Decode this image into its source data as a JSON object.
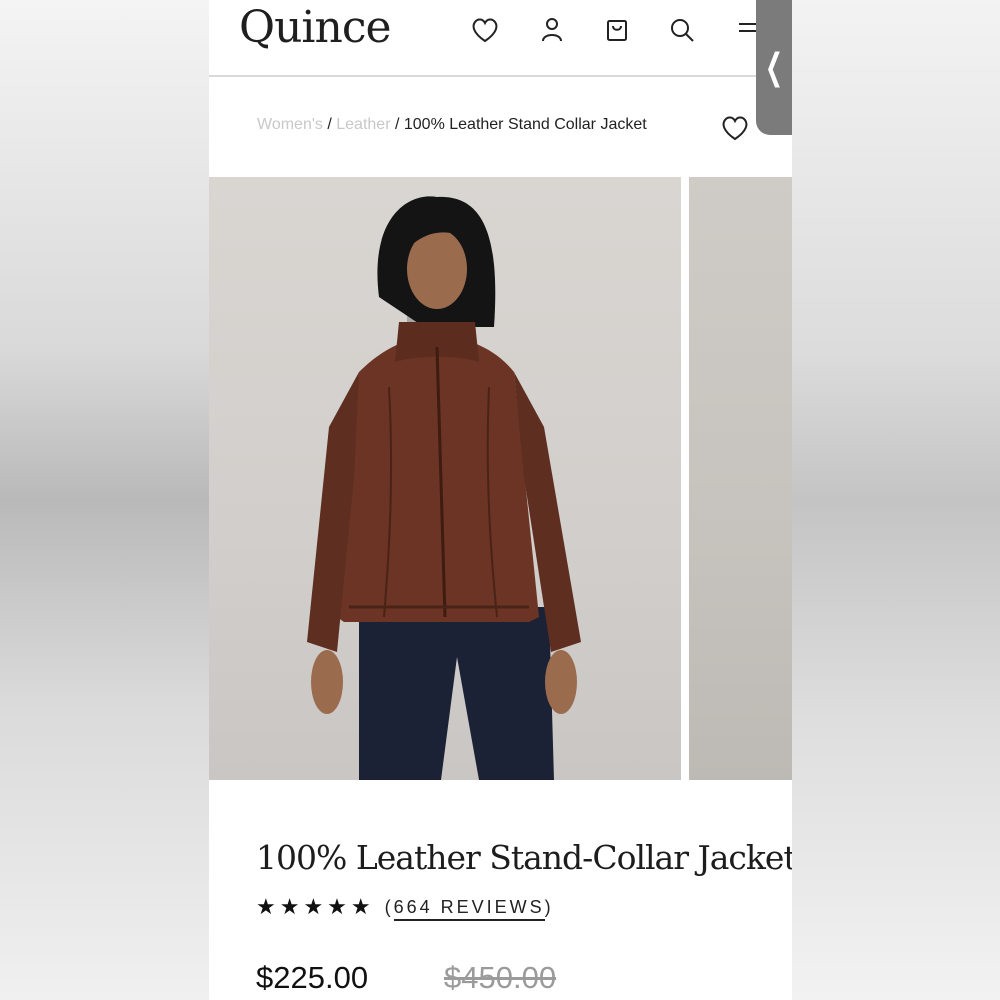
{
  "brand": {
    "logo_text": "Quince"
  },
  "header": {
    "icons": [
      "heart-icon",
      "account-icon",
      "shopping-bag-icon",
      "search-icon",
      "menu-icon"
    ]
  },
  "side_tab": {
    "glyph": "❮"
  },
  "breadcrumb": {
    "items": [
      "Women's",
      "Leather",
      "100% Leather Stand Collar Jacket"
    ],
    "separator": "/"
  },
  "product": {
    "title": "100% Leather Stand-Collar Jacket",
    "stars": "★★★★★",
    "reviews_open": "(",
    "reviews_label": "664 REVIEWS",
    "reviews_close": ")",
    "rating": 5,
    "price": "$225.00",
    "original_price": "$450.00"
  },
  "colors": {
    "jacket": "#6b3424",
    "pants": "#1b2235",
    "backdrop": "#d5d2ce"
  }
}
